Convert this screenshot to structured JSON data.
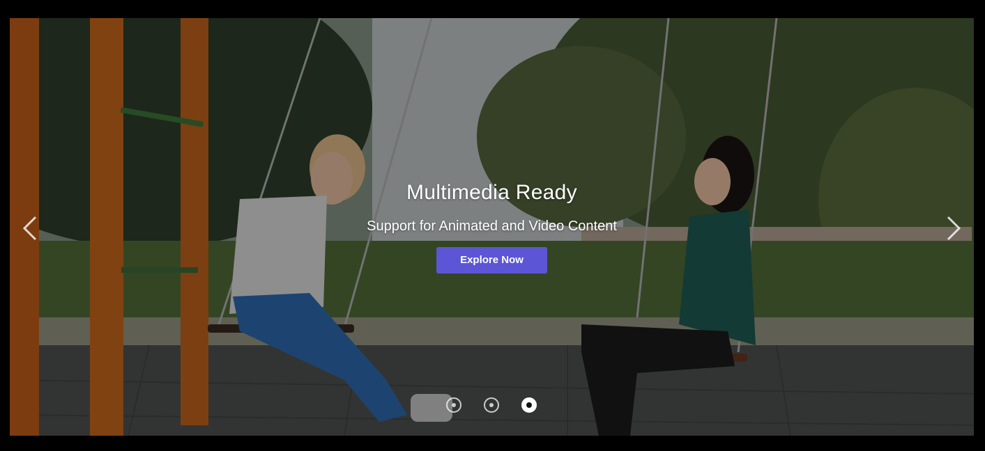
{
  "slide": {
    "title": "Multimedia Ready",
    "subtitle": "Support for Animated and Video Content",
    "cta_label": "Explore Now"
  },
  "nav": {
    "prev_icon": "chevron-left-icon",
    "next_icon": "chevron-right-icon"
  },
  "pagination": {
    "total": 3,
    "active_index": 3
  },
  "colors": {
    "accent": "#5c55d6",
    "overlay": "rgba(0,0,0,0.38)"
  }
}
